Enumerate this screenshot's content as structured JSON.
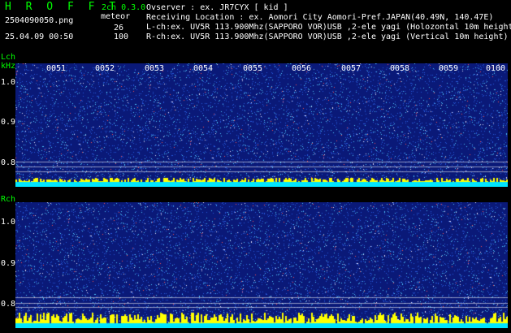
{
  "header": {
    "logo": "H R O F F T",
    "version": "2ch 0.3.0",
    "filename": "2504090050.png",
    "meteor_label": "meteor",
    "meteor_count_l": "26",
    "meteor_count_r": "100",
    "datetime": "25.04.09 00:50",
    "observer": "Ovserver          : ex. JR7CYX [ kid ]",
    "location": "Receiving Location : ex. Aomori City Aomori-Pref.JAPAN(40.49N, 140.47E)",
    "lch_info": "L-ch:ex. UV5R 113.900Mhz(SAPPORO VOR)USB ,2-ele yagi (Holozontal 10m height",
    "rch_info": "R-ch:ex. UV5R 113.900Mhz(SAPPORO VOR)USB ,2-ele yagi (Vertical 10m height)"
  },
  "lch": {
    "label": "Lch",
    "unit": "kHz",
    "ticks": [
      "1.0",
      "0.9",
      "0.8"
    ]
  },
  "rch": {
    "label": "Rch",
    "ticks": [
      "1.0",
      "0.9",
      "0.8"
    ]
  },
  "time_labels": [
    "0051",
    "0052",
    "0053",
    "0054",
    "0055",
    "0056",
    "0057",
    "0058",
    "0059",
    "0100"
  ],
  "colors": {
    "background": "#000000",
    "text": "#ffffff",
    "accent": "#00ff00",
    "spectrogram_base": "#0a1a78",
    "baseline_l": "#00e5ff",
    "baseline_r": "#ffff00"
  }
}
